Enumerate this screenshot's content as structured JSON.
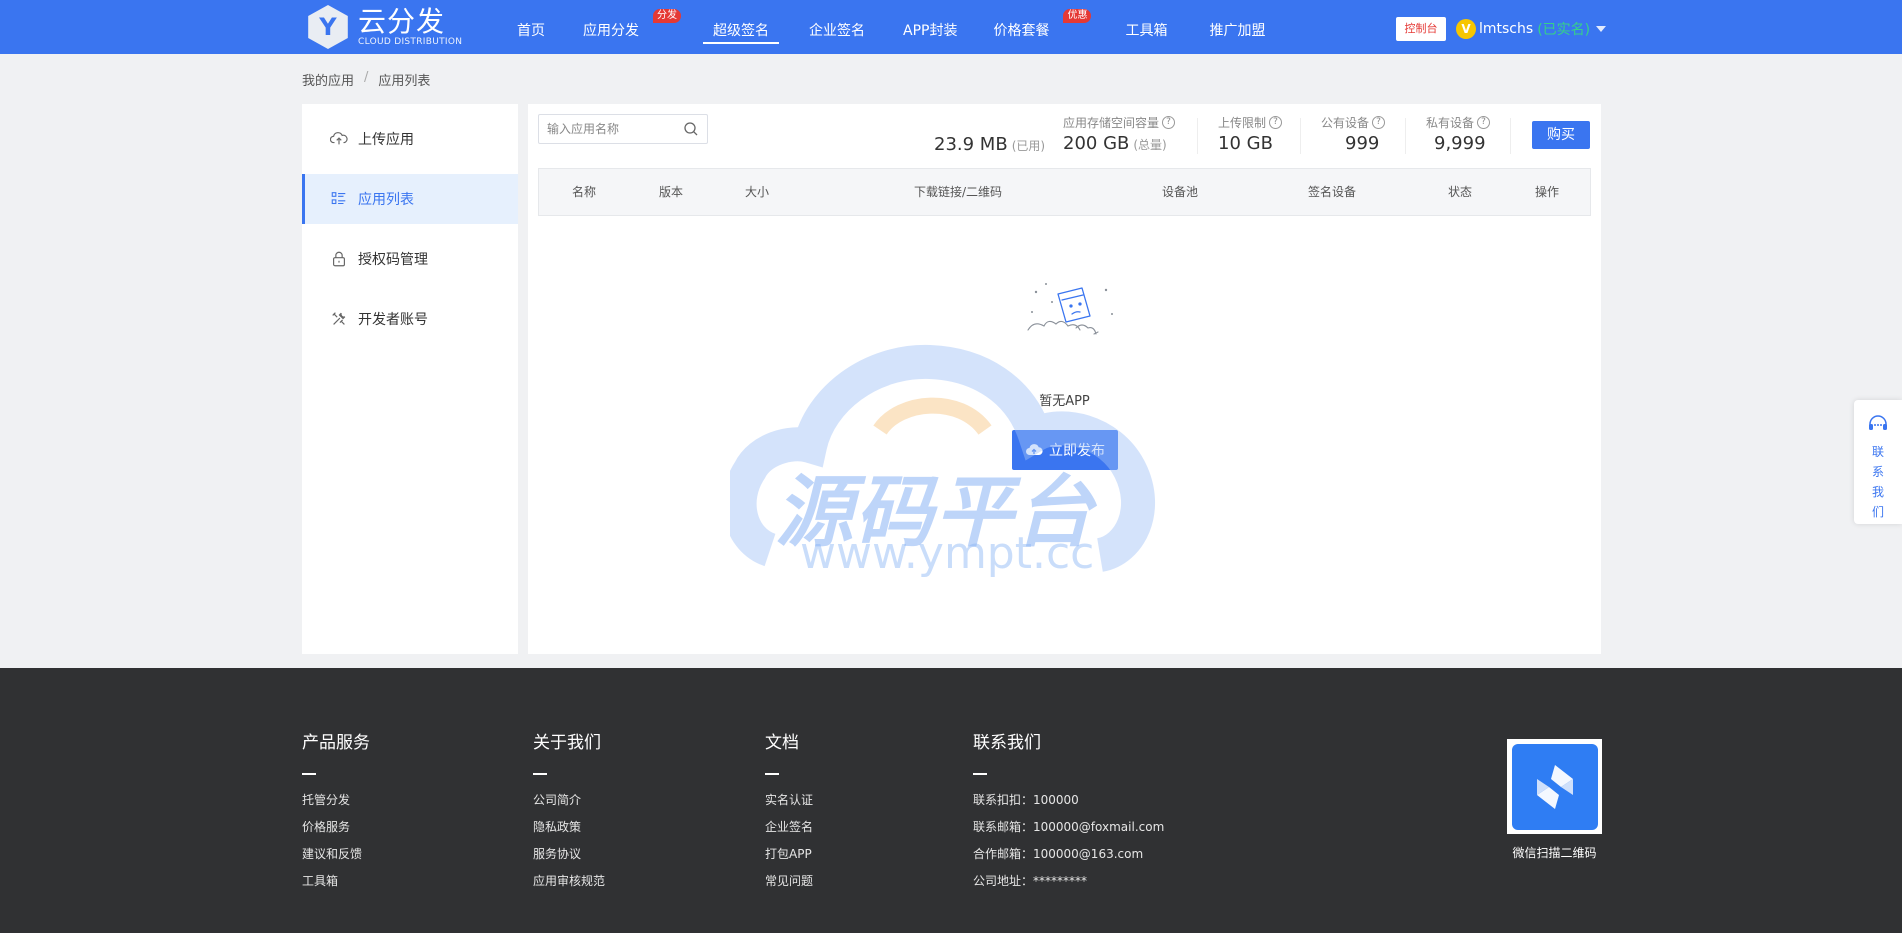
{
  "header": {
    "logo": {
      "mark": "Y",
      "title": "云分发",
      "subtitle": "CLOUD DISTRIBUTION"
    },
    "nav": [
      {
        "label": "首页",
        "badge": ""
      },
      {
        "label": "应用分发",
        "badge": "分发"
      },
      {
        "label": "超级签名",
        "badge": "",
        "active": true
      },
      {
        "label": "企业签名",
        "badge": ""
      },
      {
        "label": "APP封装",
        "badge": ""
      },
      {
        "label": "价格套餐",
        "badge": "优惠"
      },
      {
        "label": "工具箱",
        "badge": ""
      },
      {
        "label": "推广加盟",
        "badge": ""
      }
    ],
    "console_label": "控制台",
    "user": {
      "avatar_letter": "V",
      "name": "lmtschs",
      "verified": "(已实名)"
    }
  },
  "breadcrumb": {
    "items": [
      "我的应用",
      "应用列表"
    ],
    "separator": "/"
  },
  "sidebar": {
    "items": [
      {
        "label": "上传应用",
        "icon": "cloud-upload-icon"
      },
      {
        "label": "应用列表",
        "icon": "list-icon",
        "active": true
      },
      {
        "label": "授权码管理",
        "icon": "lock-icon"
      },
      {
        "label": "开发者账号",
        "icon": "tools-icon"
      }
    ]
  },
  "main": {
    "search_placeholder": "输入应用名称",
    "stats": {
      "used": {
        "value": "23.9 MB",
        "unit": "(已用)"
      },
      "storage": {
        "label": "应用存储空间容量",
        "value": "200 GB",
        "unit": "(总量)"
      },
      "upload_limit": {
        "label": "上传限制",
        "value": "10 GB"
      },
      "public_devices": {
        "label": "公有设备",
        "value": "999"
      },
      "private_devices": {
        "label": "私有设备",
        "value": "9,999"
      }
    },
    "buy_label": "购买",
    "columns": [
      "名称",
      "版本",
      "大小",
      "下载链接/二维码",
      "设备池",
      "签名设备",
      "状态",
      "操作"
    ],
    "empty_text": "暂无APP",
    "publish_label": "立即发布"
  },
  "watermark": {
    "line1": "源码平台",
    "line2": "www.ympt.cc"
  },
  "contact_float": {
    "chars": [
      "联",
      "系",
      "我",
      "们"
    ]
  },
  "footer": {
    "columns": [
      {
        "title": "产品服务",
        "links": [
          "托管分发",
          "价格服务",
          "建议和反馈",
          "工具箱"
        ]
      },
      {
        "title": "关于我们",
        "links": [
          "公司简介",
          "隐私政策",
          "服务协议",
          "应用审核规范"
        ]
      },
      {
        "title": "文档",
        "links": [
          "实名认证",
          "企业签名",
          "打包APP",
          "常见问题"
        ]
      },
      {
        "title": "联系我们",
        "links": [
          "联系扣扣：100000",
          "联系邮箱：100000@foxmail.com",
          "合作邮箱：100000@163.com",
          "公司地址：*********"
        ]
      }
    ],
    "qr_caption": "微信扫描二维码"
  },
  "colors": {
    "primary": "#3a75f0",
    "badge": "#e53935",
    "verified": "#36d18a",
    "footer_bg": "#303133"
  }
}
